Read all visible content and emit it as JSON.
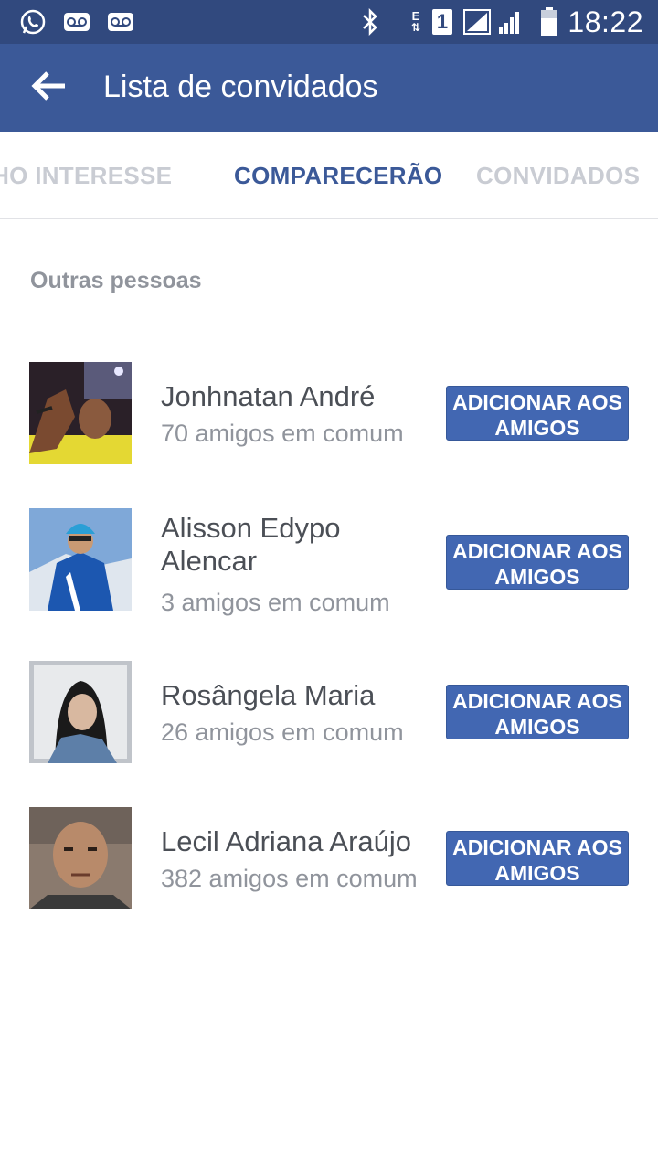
{
  "status_bar": {
    "time": "18:22",
    "icons": [
      "whatsapp-icon",
      "voicemail-icon",
      "voicemail-icon",
      "bluetooth-icon",
      "data-e-icon",
      "sim-1-icon",
      "signal-icon",
      "signal-icon",
      "battery-icon"
    ],
    "network_letter": "E",
    "sim_number": "1"
  },
  "app_bar": {
    "title": "Lista de convidados",
    "background": "#3b5998",
    "back_icon": "arrow-left-icon"
  },
  "tabs": [
    {
      "label": "NHO INTERESSE",
      "active": false
    },
    {
      "label": "COMPARECERÃO",
      "active": true
    },
    {
      "label": "CONVIDADOS",
      "active": false
    }
  ],
  "section": {
    "title": "Outras pessoas"
  },
  "people": [
    {
      "name": "Jonhnatan André",
      "mutual": "70 amigos em comum",
      "button": "ADICIONAR AOS AMIGOS"
    },
    {
      "name": "Alisson Edypo Alencar",
      "mutual": "3 amigos em comum",
      "button": "ADICIONAR AOS AMIGOS"
    },
    {
      "name": "Rosângela Maria",
      "mutual": "26 amigos em comum",
      "button": "ADICIONAR AOS AMIGOS"
    },
    {
      "name": "Lecil Adriana Araújo",
      "mutual": "382 amigos em comum",
      "button": "ADICIONAR AOS AMIGOS"
    }
  ],
  "colors": {
    "status_bar": "#31497e",
    "accent": "#3b5998",
    "button": "#4267b2"
  }
}
